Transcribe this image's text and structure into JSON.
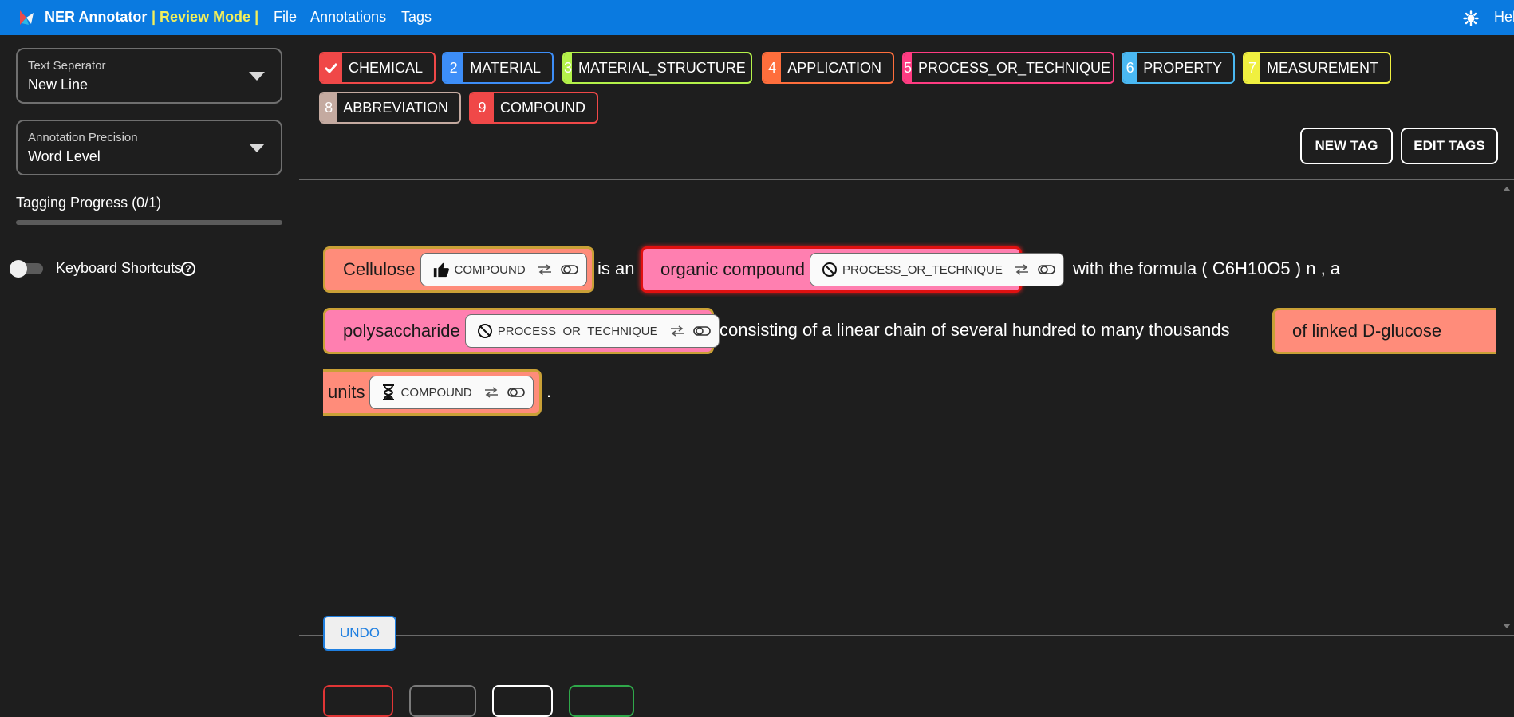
{
  "header": {
    "app_title": "NER Annotator",
    "mode_label": "| Review Mode |",
    "menu": [
      "File",
      "Annotations",
      "Tags"
    ],
    "help_label": "Help"
  },
  "sidebar": {
    "text_separator": {
      "label": "Text Seperator",
      "value": "New Line"
    },
    "annotation_precision": {
      "label": "Annotation Precision",
      "value": "Word Level"
    },
    "progress": {
      "label": "Tagging Progress (0/1)",
      "value": 0
    },
    "keyboard_shortcuts": {
      "label": "Keyboard Shortcuts",
      "enabled": false
    }
  },
  "tags": [
    {
      "key": "✓",
      "name": "CHEMICAL",
      "color": "#f04848",
      "selected": true
    },
    {
      "key": "2",
      "name": "MATERIAL",
      "color": "#3d8ef8"
    },
    {
      "key": "3",
      "name": "MATERIAL_STRUCTURE",
      "color": "#b4f24a"
    },
    {
      "key": "4",
      "name": "APPLICATION",
      "color": "#ff6e3c"
    },
    {
      "key": "5",
      "name": "PROCESS_OR_TECHNIQUE",
      "color": "#ff3c82"
    },
    {
      "key": "6",
      "name": "PROPERTY",
      "color": "#4ab8f2"
    },
    {
      "key": "7",
      "name": "MEASUREMENT",
      "color": "#f0f040"
    },
    {
      "key": "8",
      "name": "ABBREVIATION",
      "color": "#c4aaa0"
    },
    {
      "key": "9",
      "name": "COMPOUND",
      "color": "#f04848"
    }
  ],
  "actions": {
    "new_tag": "NEW TAG",
    "edit_tags": "EDIT TAGS",
    "undo": "UNDO"
  },
  "document": {
    "annotations": [
      {
        "text": "Cellulose",
        "tag": "COMPOUND",
        "status": "accepted",
        "color": "#ff8c7a",
        "border": "#c9a036"
      },
      {
        "text": "organic  compound",
        "tag": "PROCESS_OR_TECHNIQUE",
        "status": "rejected",
        "color": "#ff7fb0",
        "border": "#e01010"
      },
      {
        "text": "polysaccharide",
        "tag": "PROCESS_OR_TECHNIQUE",
        "status": "rejected",
        "color": "#ff7fb0",
        "border": "#c9a036"
      },
      {
        "text": "of  linked  D-glucose",
        "tag": "",
        "status": "",
        "color": "#ff8c7a",
        "border": "#c9a036"
      },
      {
        "text": "units",
        "tag": "COMPOUND",
        "status": "pending",
        "color": "#ff8c7a",
        "border": "#c9a036"
      }
    ],
    "plain": {
      "w1": "is  an",
      "w2": "with  the  formula  (  C6H10O5  )  n  ,  a",
      "w3": "consisting  of  a  linear  chain  of  several  hundred  to  many  thousands",
      "w4": "."
    }
  },
  "bottom_button_colors": [
    "#e03535",
    "#7a7a7a",
    "#ffffff",
    "#2fa84a"
  ]
}
